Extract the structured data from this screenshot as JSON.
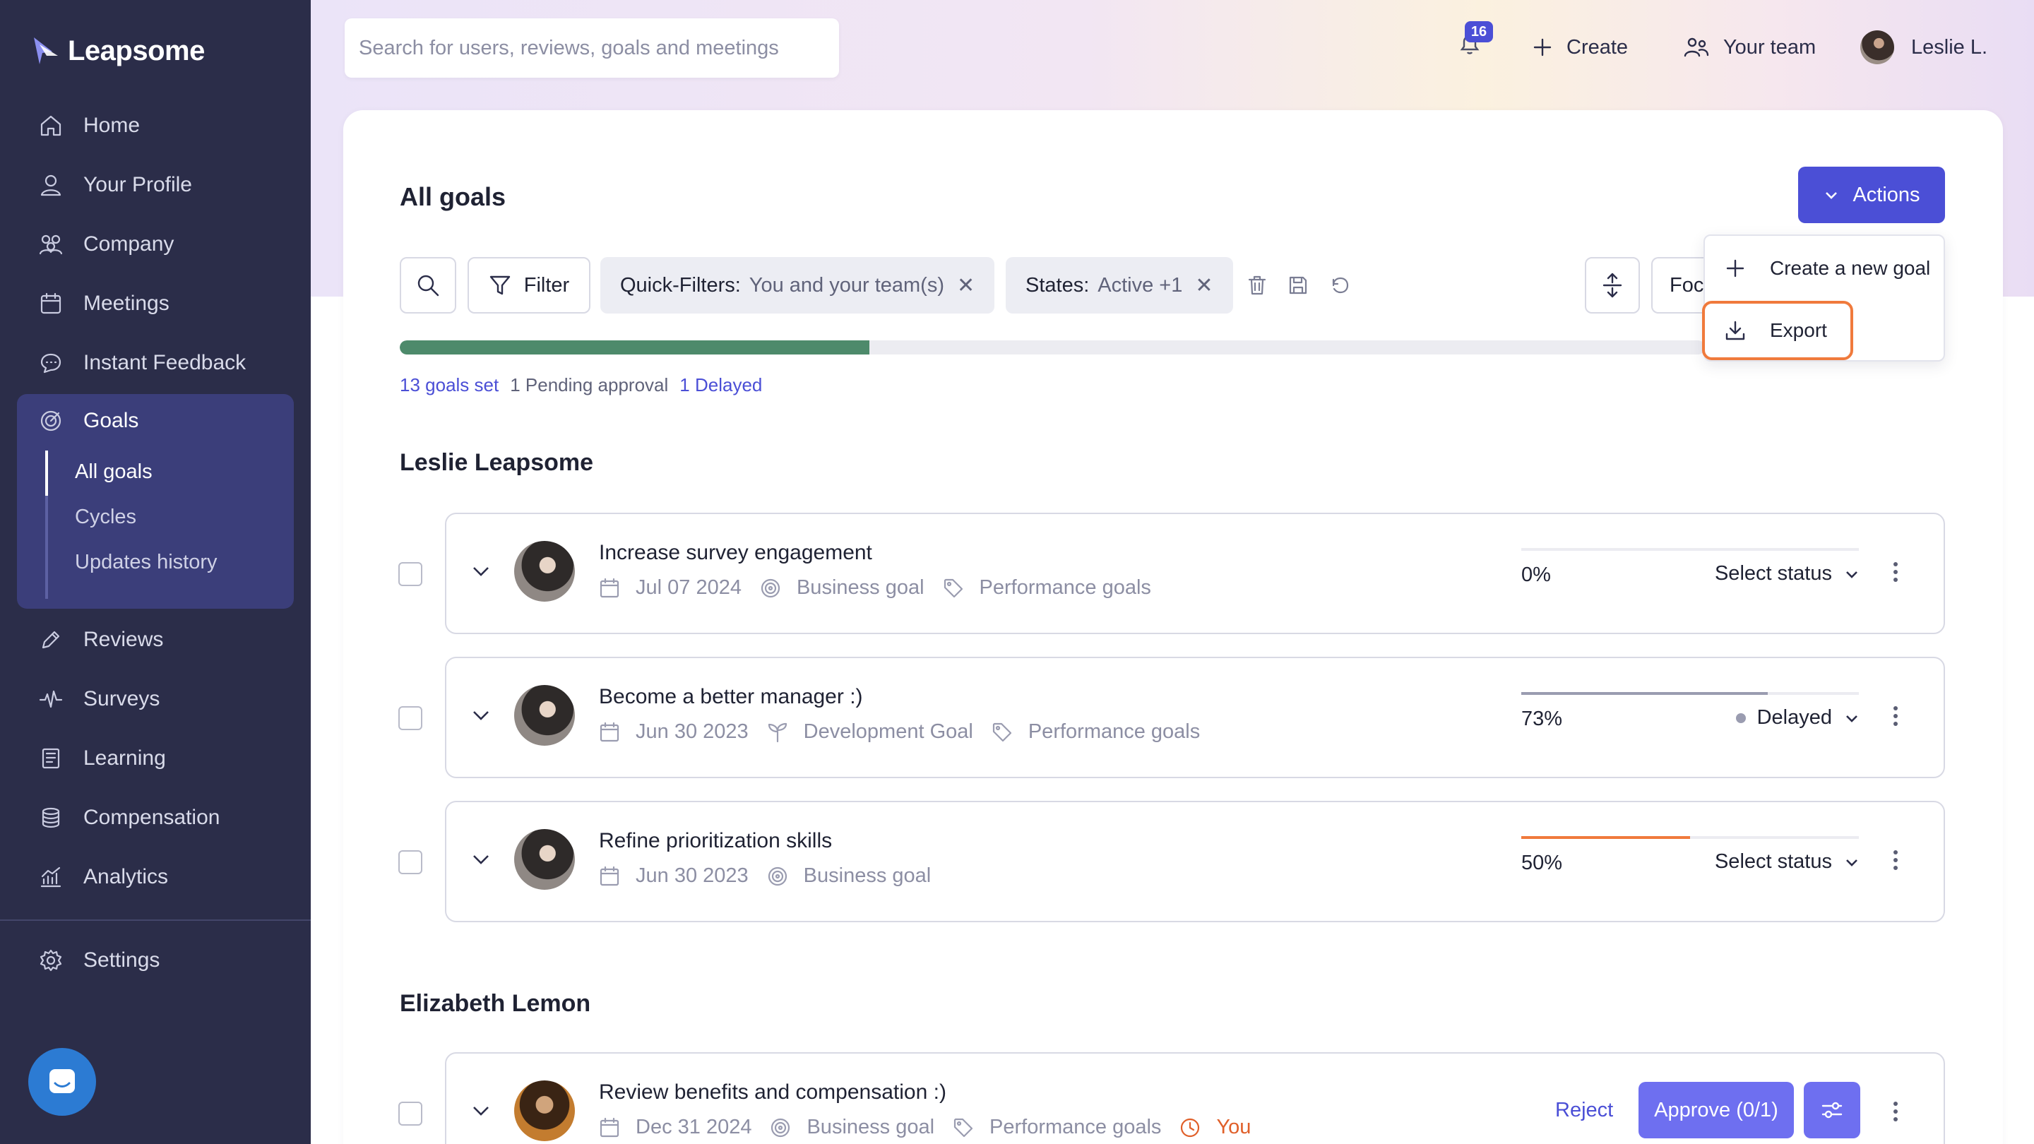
{
  "app": {
    "name": "Leapsome"
  },
  "sidebar": {
    "items": [
      {
        "label": "Home"
      },
      {
        "label": "Your Profile"
      },
      {
        "label": "Company"
      },
      {
        "label": "Meetings"
      },
      {
        "label": "Instant Feedback"
      },
      {
        "label": "Goals"
      },
      {
        "label": "Reviews"
      },
      {
        "label": "Surveys"
      },
      {
        "label": "Learning"
      },
      {
        "label": "Compensation"
      },
      {
        "label": "Analytics"
      },
      {
        "label": "Settings"
      }
    ],
    "goals_sub": [
      {
        "label": "All goals"
      },
      {
        "label": "Cycles"
      },
      {
        "label": "Updates history"
      }
    ]
  },
  "topbar": {
    "search_placeholder": "Search for users, reviews, goals and meetings",
    "notifications_count": "16",
    "create_label": "Create",
    "team_label": "Your team",
    "user_label": "Leslie L."
  },
  "page": {
    "title": "All goals",
    "actions_label": "Actions",
    "filter_label": "Filter",
    "quick_filters_label": "Quick-Filters:",
    "quick_filters_value": "You and your team(s)",
    "states_label": "States:",
    "states_value": "Active +1",
    "focus_label": "Focus",
    "progress_fraction": 0.36,
    "stats": {
      "set": "13 goals set",
      "pending": "1 Pending approval",
      "delayed": "1 Delayed"
    }
  },
  "dropdown": {
    "create": "Create a new goal",
    "export": "Export"
  },
  "sections": [
    {
      "owner": "Leslie Leapsome",
      "goals": [
        {
          "title": "Increase survey engagement",
          "date": "Jul 07 2024",
          "type": "Business goal",
          "tag": "Performance goals",
          "progress": "0%",
          "progress_value": 0,
          "status": "Select status"
        },
        {
          "title": "Become a better manager :)",
          "date": "Jun 30 2023",
          "type": "Development Goal",
          "tag": "Performance goals",
          "progress": "73%",
          "progress_value": 0.73,
          "status": "Delayed"
        },
        {
          "title": "Refine prioritization skills",
          "date": "Jun 30 2023",
          "type": "Business goal",
          "progress": "50%",
          "progress_value": 0.5,
          "status": "Select status"
        }
      ]
    },
    {
      "owner": "Elizabeth Lemon",
      "goals": [
        {
          "title": "Review benefits and compensation :)",
          "date": "Dec 31 2024",
          "type": "Business goal",
          "tag": "Performance goals",
          "assignee": "You",
          "reject_label": "Reject",
          "approve_label": "Approve (0/1)"
        }
      ]
    }
  ],
  "colors": {
    "sidebar_bg": "#2b2d49",
    "accent": "#4b4fd6",
    "progress_green": "#4d8a6b",
    "progress_orange": "#f07a3c",
    "highlight": "#f07a3c"
  }
}
